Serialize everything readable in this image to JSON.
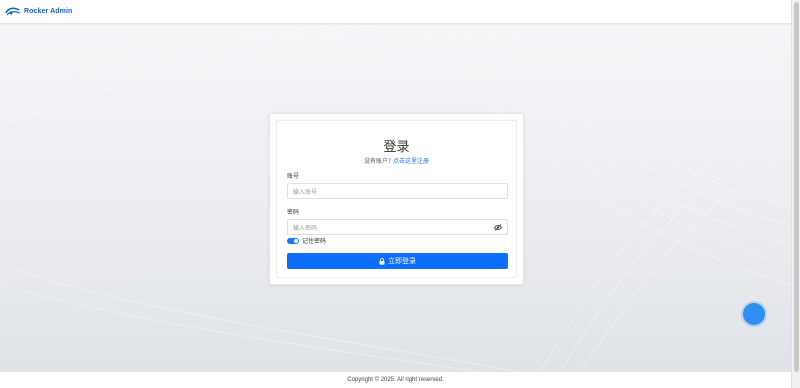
{
  "app": {
    "brand": "Rocker Admin",
    "brand_color": "#1565c0"
  },
  "login": {
    "title": "登录",
    "subtitle_prefix": "没有账户?",
    "register_link": "点击这里注册",
    "account_label": "账号",
    "account_placeholder": "输入账号",
    "password_label": "密码",
    "password_placeholder": "输入密码",
    "remember_label": "记住密码",
    "remember_checked": true,
    "submit_label": "立即登录",
    "accent_color": "#0d6efd"
  },
  "icons": {
    "logo": "rocker-logo-icon",
    "eye": "eye-slash-icon",
    "lock": "lock-icon"
  },
  "footer": {
    "copyright": "Copyright © 2025. All right reserved."
  }
}
